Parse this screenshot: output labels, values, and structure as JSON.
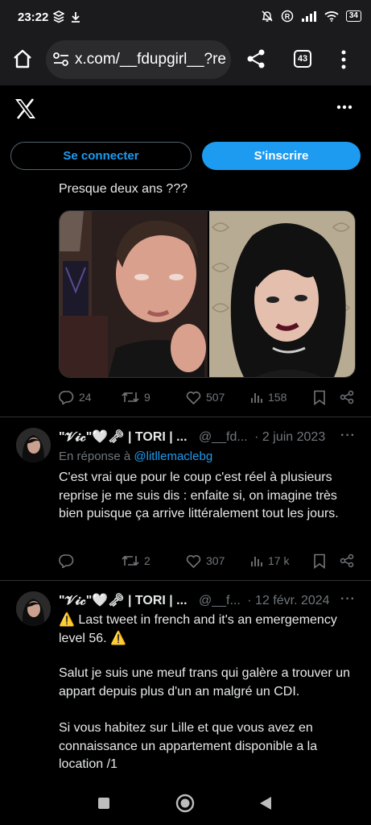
{
  "status": {
    "time": "23:22",
    "battery": "34"
  },
  "browser": {
    "url": "x.com/__fdupgirl__?re",
    "tab_count": "43"
  },
  "auth": {
    "login": "Se connecter",
    "signup": "S'inscrire"
  },
  "tweet1": {
    "text": "Presque deux ans ???",
    "replies": "24",
    "retweets": "9",
    "likes": "507",
    "views": "158"
  },
  "tweet2": {
    "name": "\"𝓥𝓲𝓬\"🤍🗝 | TORI | ...",
    "handle": "@__fd...",
    "date": "· 2 juin 2023",
    "reply_prefix": "En réponse à ",
    "reply_handle": "@litllemaclebg",
    "text": "C'est vrai que pour le coup c'est réel à plusieurs reprise je me suis dis : enfaite si, on imagine très bien puisque ça arrive littéralement tout les jours.",
    "replies": "",
    "retweets": "2",
    "likes": "307",
    "views": "17 k"
  },
  "tweet3": {
    "name": "\"𝓥𝓲𝓬\"🤍🗝 | TORI | ...",
    "handle": "@__f...",
    "date": "· 12 févr. 2024",
    "line1": "⚠️ Last tweet in french and it's an emergemency level 56. ⚠️",
    "line2": "Salut je suis une meuf trans qui galère a trouver un appart depuis plus d'un an malgré un CDI.",
    "line3": "Si vous habitez sur Lille et que vous avez en connaissance un appartement disponible a la location /1"
  },
  "colors": {
    "accent": "#1d9bf0",
    "muted": "#71767b",
    "divider": "#2f3336"
  }
}
